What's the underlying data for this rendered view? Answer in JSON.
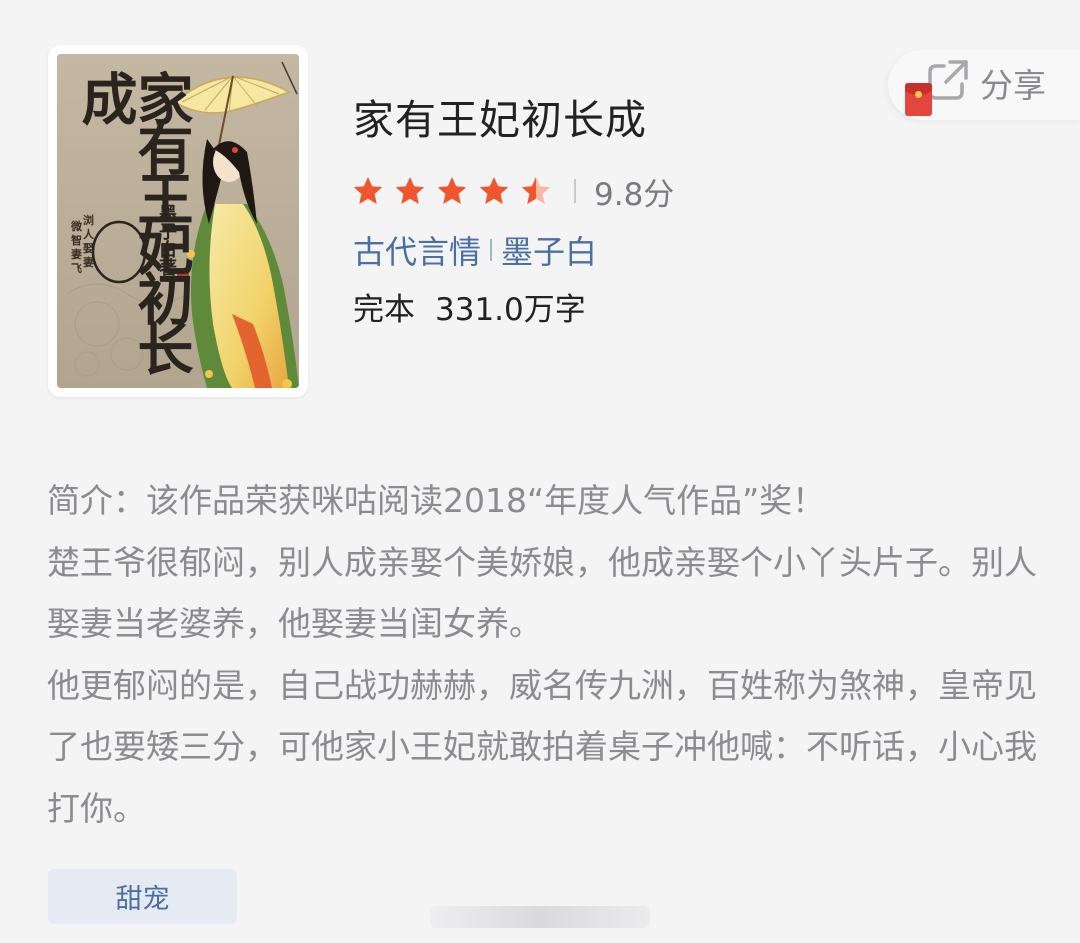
{
  "book": {
    "title": "家有王妃初长成",
    "cover": {
      "title_text": "家有王妃初长成",
      "author_text": "墨子白著"
    },
    "rating": {
      "stars": 4.5,
      "max_stars": 5,
      "score": "9.8分"
    },
    "category": "古代言情",
    "author": "墨子白",
    "status": "完本",
    "word_count": "331.0万字"
  },
  "share": {
    "label": "分享",
    "icon": "share-icon",
    "envelope_icon": "red-envelope-icon"
  },
  "intro": {
    "lines": [
      "简介：该作品荣获咪咕阅读2018“年度人气作品”奖！",
      "楚王爷很郁闷，别人成亲娶个美娇娘，他成亲娶个小丫头片子。别人娶妻当老婆养，他娶妻当闺女养。",
      "他更郁闷的是，自己战功赫赫，威名传九洲，百姓称为煞神，皇帝见了也要矮三分，可他家小王妃就敢拍着桌子冲他喊：不听话，小心我打你。"
    ]
  },
  "tags": [
    "甜宠"
  ],
  "colors": {
    "star": "#f0562e",
    "link": "#4a6fa6",
    "intro_text": "#8b8b90",
    "background": "#f4f4f5",
    "tag_bg": "#e6ebf3"
  }
}
